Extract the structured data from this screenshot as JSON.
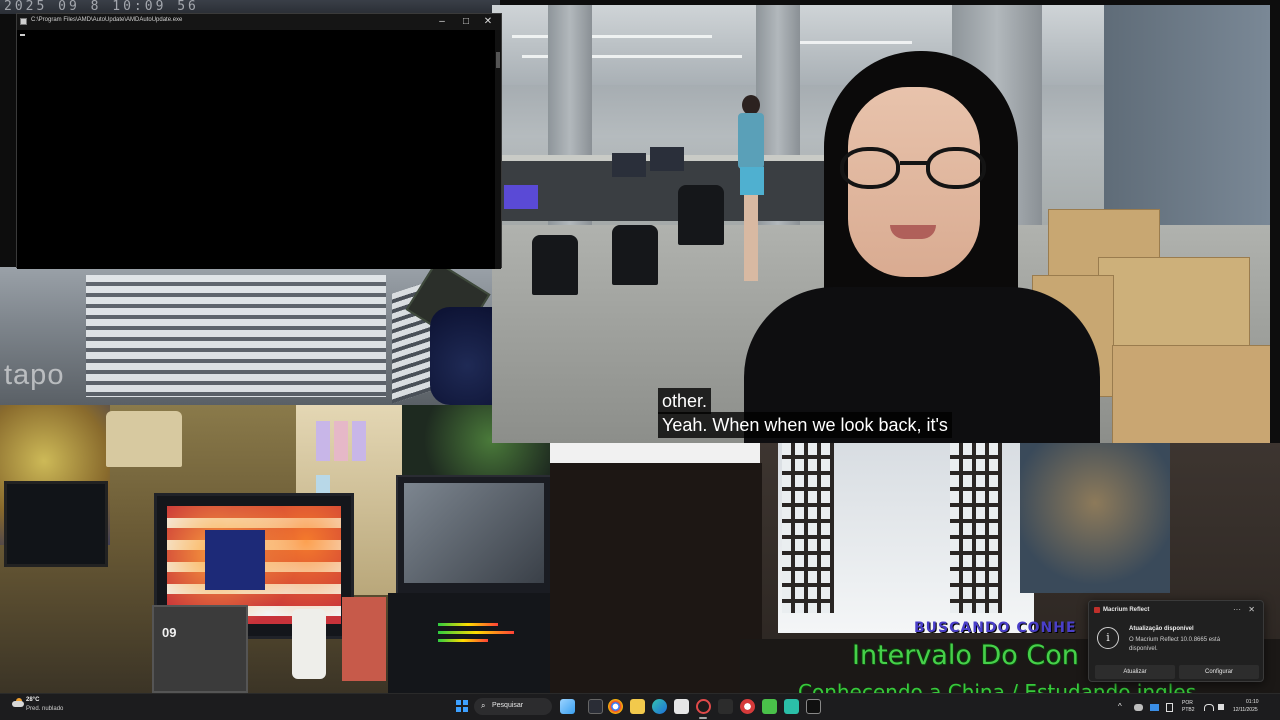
{
  "background": {
    "clock_overlay": "2025 09 8 10:09 56",
    "tapo_watermark": "tapo",
    "calendar_day": "09"
  },
  "video": {
    "subtitle_line1": "other.",
    "subtitle_line2": "Yeah. When when we look back, it's"
  },
  "console": {
    "title": "C:\\Program Files\\AMD\\AutoUpdate\\AMDAutoUpdate.exe",
    "minimize_glyph": "–",
    "maximize_glyph": "□",
    "close_glyph": "✕"
  },
  "overlay": {
    "buscando": "BUSCANDO CONHE",
    "intervalo": "Intervalo Do Con",
    "conhecendo": "Conhecendo a China / Estudando ingles"
  },
  "toast": {
    "app_name": "Macrium Reflect",
    "more_glyph": "···",
    "close_glyph": "✕",
    "info_glyph": "i",
    "title": "Atualização disponível",
    "message": "O Macrium Reflect 10.0.8665 está disponível.",
    "btn_update": "Atualizar",
    "btn_configure": "Configurar"
  },
  "taskbar": {
    "weather_temp": "28°C",
    "weather_desc": "Pred. nublado",
    "search_placeholder": "Pesquisar",
    "search_glyph": "⌕",
    "lang_line1": "POR",
    "lang_line2": "PTB2",
    "time": "01:10",
    "date": "12/11/2025",
    "tray_chevron": "^"
  },
  "colors": {
    "taskbar_bg": "#1c1c1e",
    "overlay_green": "#46d04a",
    "overlay_blue": "#4a3fc9",
    "start_blue": "#3da0ff"
  }
}
